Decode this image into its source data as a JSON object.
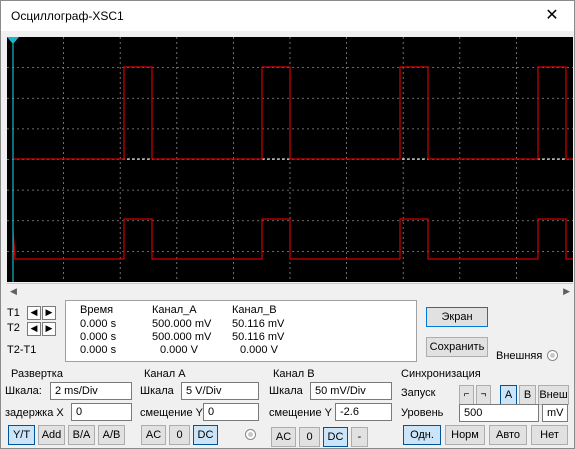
{
  "window": {
    "title": "Осциллограф-XSC1",
    "close_glyph": "✕"
  },
  "screen": {
    "background": "#000000",
    "trace_a_color": "#d00000",
    "grid_color": "#8c8c8c"
  },
  "cursors": {
    "t1_label": "T1",
    "t2_label": "T2",
    "t2t1_label": "T2-T1",
    "left_icon": "arrow-left-icon",
    "right_icon": "arrow-right-icon"
  },
  "readout": {
    "headers": [
      "Время",
      "Канал_A",
      "Канал_B"
    ],
    "rows": [
      [
        "0.000 s",
        "500.000 mV",
        "50.116 mV"
      ],
      [
        "0.000 s",
        "500.000 mV",
        "50.116 mV"
      ],
      [
        "0.000 s",
        "0.000 V",
        "0.000 V"
      ]
    ]
  },
  "actions": {
    "screen_label": "Экран",
    "save_label": "Сохранить",
    "external_label": "Внешняя"
  },
  "timebase": {
    "title": "Развертка",
    "scale_label": "Шкала:",
    "scale_value": "2 ms/Div",
    "delay_label": "задержка X",
    "delay_value": "0",
    "modes": [
      "Y/T",
      "Add",
      "B/A",
      "A/B"
    ],
    "active_mode": "Y/T"
  },
  "channel_a": {
    "title": "Канал A",
    "scale_label": "Шкала",
    "scale_value": "5  V/Div",
    "offset_label": "смещение Y",
    "offset_value": "0",
    "couplings": [
      "AC",
      "0",
      "DC"
    ],
    "active": "DC"
  },
  "channel_b": {
    "title": "Канал B",
    "scale_label": "Шкала",
    "scale_value": "50 mV/Div",
    "offset_label": "смещение Y",
    "offset_value": "-2.6",
    "couplings": [
      "AC",
      "0",
      "DC",
      "-"
    ],
    "active": "DC"
  },
  "trigger": {
    "title": "Синхронизация",
    "start_label": "Запуск",
    "edges": [
      "rising-edge-icon",
      "falling-edge-icon"
    ],
    "sources": [
      "A",
      "B",
      "Внеш"
    ],
    "active_source": "A",
    "level_label": "Уровень",
    "level_value": "500",
    "level_unit": "mV",
    "modes": [
      "Одн.",
      "Норм",
      "Авто",
      "Нет"
    ],
    "active_mode": "Одн."
  }
}
